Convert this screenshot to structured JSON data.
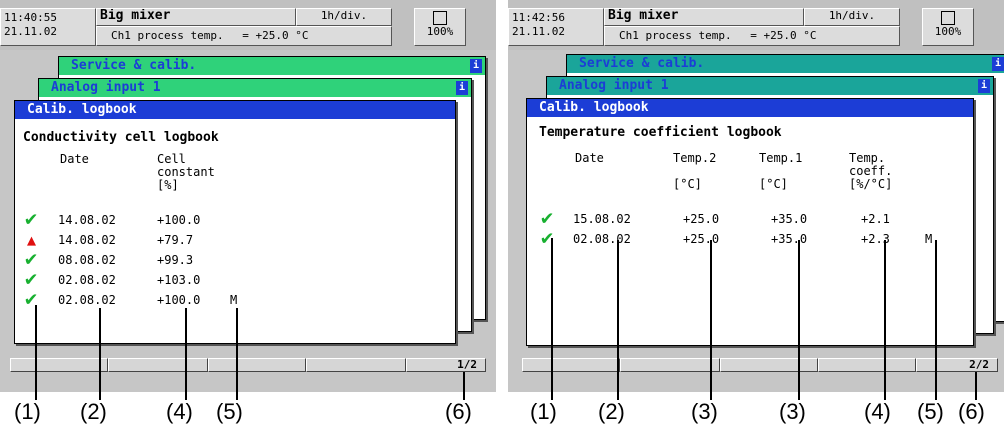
{
  "panels": [
    {
      "header": {
        "time": "11:40:55",
        "date": "21.11.02",
        "instrument": "Big mixer",
        "timebase": "1h/div.",
        "channel_label": "Ch1 process temp.",
        "channel_value": "= +25.0 °C",
        "memory": "100%"
      },
      "windows": {
        "back": "Service & calib.",
        "mid": "Analog input 1",
        "front": "Calib. logbook",
        "info_icon": "i"
      },
      "logbook": {
        "title": "Conductivity cell logbook",
        "columns": [
          "Date",
          "Cell\nconstant\n[%]"
        ],
        "rows": [
          {
            "status": "ok",
            "date": "14.08.02",
            "value": "+100.0",
            "flag": ""
          },
          {
            "status": "alarm",
            "date": "14.08.02",
            "value": "+79.7",
            "flag": ""
          },
          {
            "status": "ok",
            "date": "08.08.02",
            "value": "+99.3",
            "flag": ""
          },
          {
            "status": "ok",
            "date": "02.08.02",
            "value": "+103.0",
            "flag": ""
          },
          {
            "status": "ok",
            "date": "02.08.02",
            "value": "+100.0",
            "flag": "M"
          }
        ]
      },
      "page": "1/2",
      "callouts": [
        "(1)",
        "(2)",
        "(4)",
        "(5)",
        "(6)"
      ]
    },
    {
      "header": {
        "time": "11:42:56",
        "date": "21.11.02",
        "instrument": "Big mixer",
        "timebase": "1h/div.",
        "channel_label": "Ch1 process temp.",
        "channel_value": "= +25.0 °C",
        "memory": "100%"
      },
      "windows": {
        "back": "Service & calib.",
        "mid": "Analog input 1",
        "front": "Calib. logbook",
        "info_icon": "i"
      },
      "logbook": {
        "title": "Temperature coefficient logbook",
        "columns": [
          "Date",
          "Temp.2\n\n[°C]",
          "Temp.1\n\n[°C]",
          "Temp.\ncoeff.\n[%/°C]"
        ],
        "rows": [
          {
            "status": "ok",
            "date": "15.08.02",
            "t2": "+25.0",
            "t1": "+35.0",
            "coeff": "+2.1",
            "flag": ""
          },
          {
            "status": "ok",
            "date": "02.08.02",
            "t2": "+25.0",
            "t1": "+35.0",
            "coeff": "+2.3",
            "flag": "M"
          }
        ]
      },
      "page": "2/2",
      "callouts": [
        "(1)",
        "(2)",
        "(3)",
        "(3)",
        "(4)",
        "(5)",
        "(6)"
      ]
    }
  ]
}
